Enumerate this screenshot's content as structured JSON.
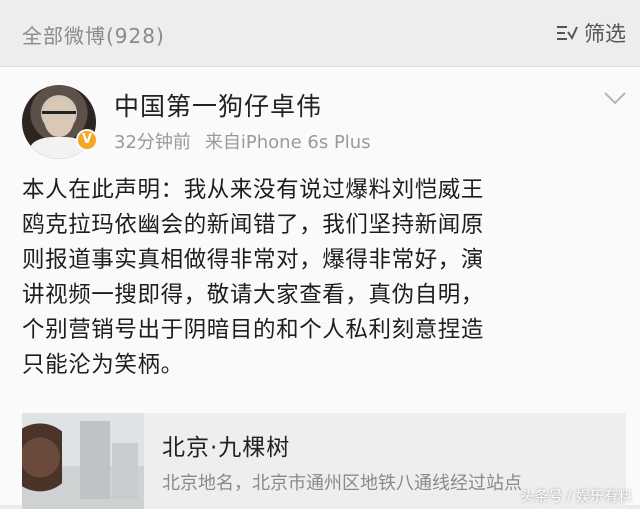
{
  "header": {
    "all_posts_label": "全部微博(928)",
    "filter_label": "筛选"
  },
  "post": {
    "username": "中国第一狗仔卓伟",
    "time": "32分钟前",
    "source": "来自iPhone 6s Plus",
    "verified_badge": "V",
    "body_lines": [
      "本人在此声明：我从来没有说过爆料刘恺威王",
      "鸥克拉玛依幽会的新闻错了，我们坚持新闻原",
      "则报道事实真相做得非常对，爆得非常好，演",
      "讲视频一搜即得，敬请大家查看，真伪自明，",
      "个别营销号出于阴暗目的和个人私利刻意捏造",
      "只能沦为笑柄。"
    ]
  },
  "location": {
    "title": "北京·九棵树",
    "description": "北京地名，北京市通州区地铁八通线经过站点"
  },
  "watermark": "头条号 / 娱乐有料",
  "colors": {
    "badge": "#f5a623",
    "muted_text": "#9a9a9a",
    "card_bg": "#fafafa"
  }
}
